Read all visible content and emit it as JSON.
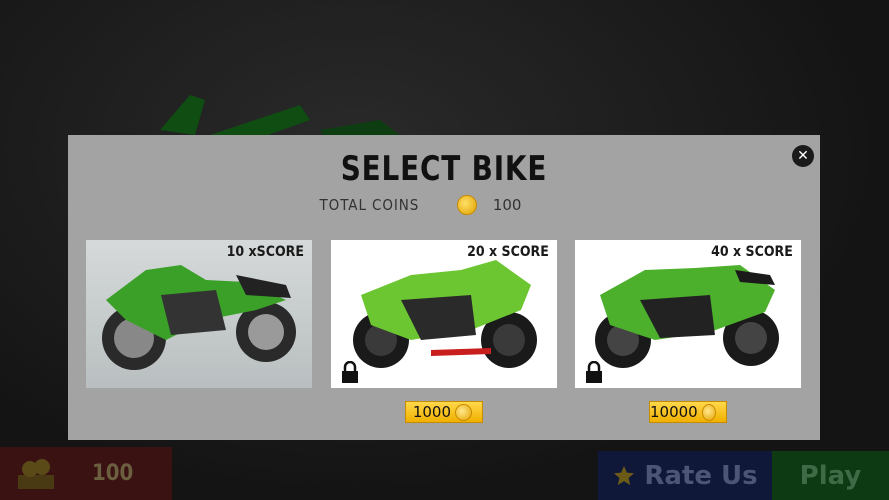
{
  "dialog": {
    "title": "SELECT BIKE",
    "total_coins_label": "TOTAL COINS",
    "total_coins_value": "100",
    "close_icon": "close-icon"
  },
  "bikes": [
    {
      "score": "10 xSCORE",
      "locked": false,
      "color": "#3aa028"
    },
    {
      "score": "20 x SCORE",
      "locked": true,
      "price": "1000",
      "color": "#6cc631"
    },
    {
      "score": "40 x SCORE",
      "locked": true,
      "price": "10000",
      "color": "#4db02c"
    }
  ],
  "bottom_bar": {
    "coins_value": "100",
    "rate_label": "Rate Us",
    "play_label": "Play"
  },
  "colors": {
    "dialog_bg": "#a3a3a3",
    "price_button": "#f0b000",
    "bike_green": "#3aa028"
  }
}
